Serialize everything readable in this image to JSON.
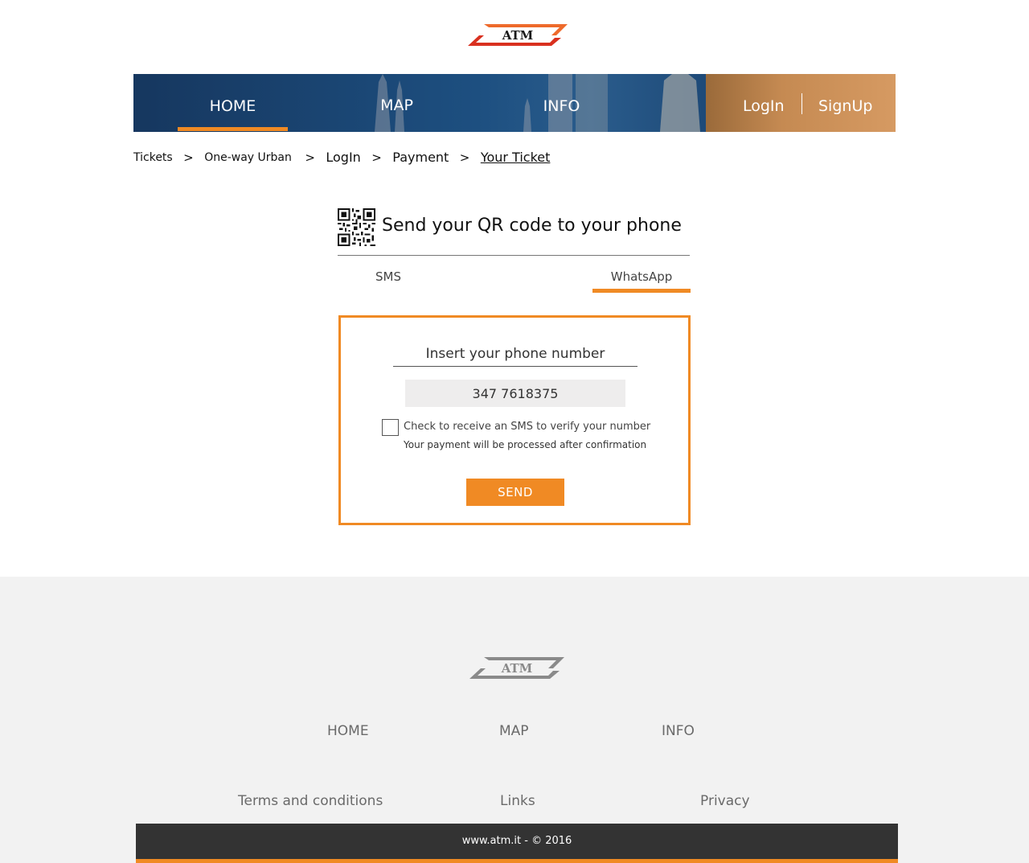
{
  "brand": {
    "logo_text": "ATM",
    "accent_color": "#f08a24",
    "logo_red": "#d9301f",
    "logo_orange": "#ee6a2b"
  },
  "nav": {
    "items": [
      {
        "label": "HOME",
        "active": true
      },
      {
        "label": "MAP",
        "active": false
      },
      {
        "label": "INFO",
        "active": false
      }
    ],
    "login_label": "LogIn",
    "signup_label": "SignUp"
  },
  "breadcrumb": {
    "items": [
      "Tickets",
      "One-way Urban",
      "LogIn",
      "Payment",
      "Your Ticket"
    ],
    "separator": ">"
  },
  "main": {
    "title": "Send your QR code to your phone",
    "title_icon": "qr-code-icon",
    "tabs": [
      {
        "label": "SMS",
        "active": false
      },
      {
        "label": "WhatsApp",
        "active": true
      }
    ],
    "form": {
      "phone_label": "Insert your phone number",
      "phone_value": "347 7618375",
      "checkbox_label": "Check to receive an SMS to verify your number",
      "checkbox_checked": false,
      "note": "Your payment will be processed after confirmation",
      "send_label": "SEND"
    }
  },
  "footer": {
    "nav": [
      "HOME",
      "MAP",
      "INFO"
    ],
    "links": [
      "Terms and conditions",
      "Links",
      "Privacy"
    ],
    "copyright": "www.atm.it - © 2016",
    "logo_color": "#8a8a8a"
  }
}
